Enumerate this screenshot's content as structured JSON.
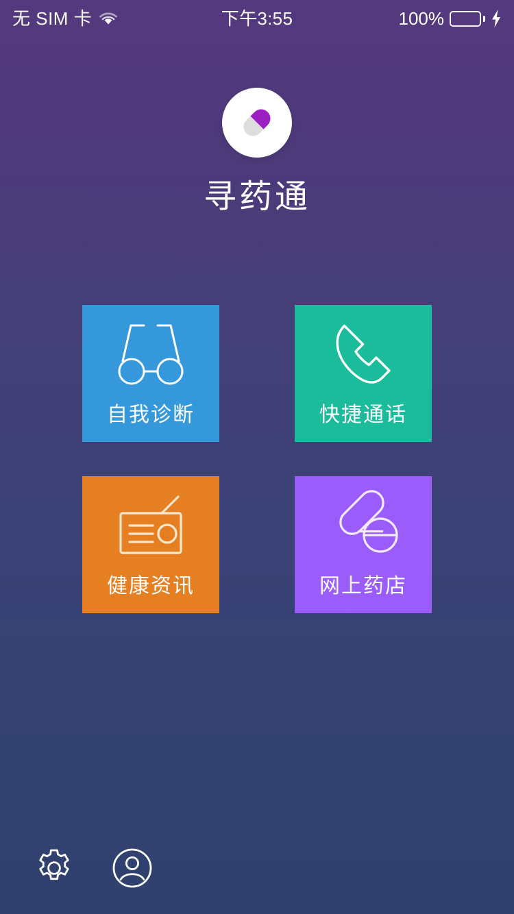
{
  "status_bar": {
    "carrier": "无 SIM 卡",
    "wifi_icon": "wifi-icon",
    "time": "下午3:55",
    "battery_percent": "100%",
    "battery_icon": "battery-icon",
    "charging_icon": "lightning-bolt-icon",
    "battery_color": "#4CD964",
    "text_color": "#FFFFFF"
  },
  "branding": {
    "logo_icon": "pill-capsule-logo",
    "logo_circle_color": "#FFFFFF",
    "logo_capsule_purple": "#9B1FC1",
    "logo_capsule_gray": "#DDDDDD",
    "app_name": "寻药通"
  },
  "background": {
    "gradient_top": "#55397E",
    "gradient_bottom": "#30416E"
  },
  "tiles": [
    {
      "id": "self-diagnosis",
      "label": "自我诊断",
      "color": "#3498DB",
      "icon": "stethoscope-glasses-icon"
    },
    {
      "id": "quick-call",
      "label": "快捷通话",
      "color": "#1ABC9C",
      "icon": "phone-handset-icon"
    },
    {
      "id": "health-news",
      "label": "健康资讯",
      "color": "#E67E22",
      "icon": "radio-icon"
    },
    {
      "id": "online-pharmacy",
      "label": "网上药店",
      "color": "#9B5CFC",
      "icon": "pills-icon"
    }
  ],
  "bottom_bar": {
    "settings_icon": "gear-icon",
    "profile_icon": "user-account-icon",
    "icon_color": "#FFFFFF"
  }
}
